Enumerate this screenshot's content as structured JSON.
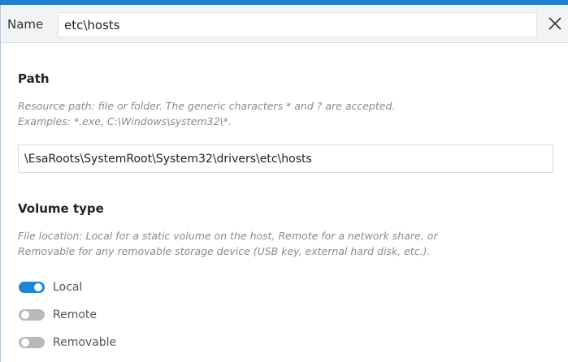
{
  "header": {
    "name_label": "Name",
    "name_value": "etc\\hosts",
    "close_glyph": "close-icon"
  },
  "path_section": {
    "title": "Path",
    "description_line1": "Resource path: file or folder. The generic characters * and ? are accepted.",
    "description_line2": "Examples: *.exe, C:\\Windows\\system32\\*.",
    "value": "\\EsaRoots\\SystemRoot\\System32\\drivers\\etc\\hosts"
  },
  "volume_section": {
    "title": "Volume type",
    "description_line1": "File location: Local for a static volume on the host, Remote for a network share, or",
    "description_line2": "Removable for any removable storage device (USB key, external hard disk, etc.).",
    "options": [
      {
        "label": "Local",
        "selected": true
      },
      {
        "label": "Remote",
        "selected": false
      },
      {
        "label": "Removable",
        "selected": false
      }
    ]
  },
  "colors": {
    "accent": "#1f84d3",
    "background": "#1f7fcf",
    "toggle_off": "#b9b9b9",
    "description_text": "#8a8a8a"
  }
}
